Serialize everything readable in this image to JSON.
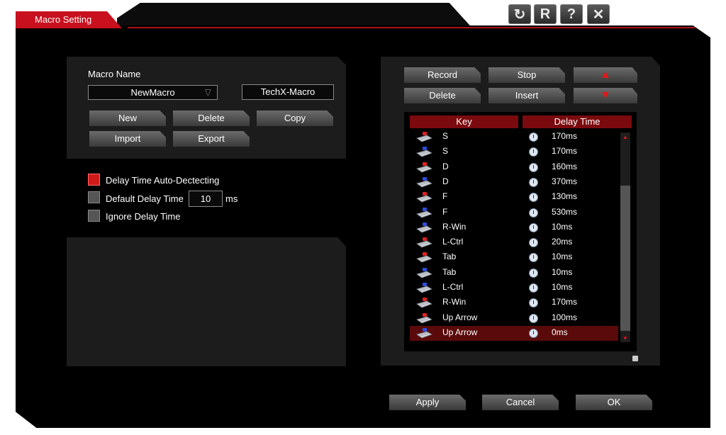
{
  "window": {
    "title": "Macro Setting",
    "buttons": {
      "refresh": "↻",
      "reset": "R",
      "help": "?",
      "close": "✕"
    }
  },
  "macro": {
    "name_label": "Macro Name",
    "name_value": "NewMacro",
    "profile_value": "TechX-Macro",
    "buttons": {
      "new": "New",
      "delete": "Delete",
      "copy": "Copy",
      "import": "Import",
      "export": "Export"
    }
  },
  "options": {
    "delay_auto": {
      "label": "Delay Time Auto-Dectecting",
      "checked": true
    },
    "default_delay": {
      "label": "Default Delay Time",
      "value": "10",
      "unit": "ms",
      "checked": false
    },
    "ignore_delay": {
      "label": "Ignore Delay Time",
      "checked": false
    }
  },
  "recorder": {
    "record": "Record",
    "stop": "Stop",
    "delete": "Delete",
    "insert": "Insert",
    "move_up_icon": "triangle-up-icon",
    "move_down_icon": "triangle-down-icon"
  },
  "table": {
    "headers": {
      "key": "Key",
      "delay": "Delay Time"
    },
    "rows": [
      {
        "key": "S",
        "delay": "170ms",
        "action": "press"
      },
      {
        "key": "S",
        "delay": "170ms",
        "action": "release"
      },
      {
        "key": "D",
        "delay": "160ms",
        "action": "press"
      },
      {
        "key": "D",
        "delay": "370ms",
        "action": "release"
      },
      {
        "key": "F",
        "delay": "130ms",
        "action": "press"
      },
      {
        "key": "F",
        "delay": "530ms",
        "action": "release"
      },
      {
        "key": "R-Win",
        "delay": "10ms",
        "action": "release"
      },
      {
        "key": "L-Ctrl",
        "delay": "20ms",
        "action": "press"
      },
      {
        "key": "Tab",
        "delay": "10ms",
        "action": "press"
      },
      {
        "key": "Tab",
        "delay": "10ms",
        "action": "release"
      },
      {
        "key": "L-Ctrl",
        "delay": "10ms",
        "action": "release"
      },
      {
        "key": "R-Win",
        "delay": "170ms",
        "action": "press"
      },
      {
        "key": "Up Arrow",
        "delay": "100ms",
        "action": "press"
      },
      {
        "key": "Up Arrow",
        "delay": "0ms",
        "action": "release",
        "selected": true
      }
    ]
  },
  "footer": {
    "apply": "Apply",
    "cancel": "Cancel",
    "ok": "OK"
  },
  "colors": {
    "accent": "#c8101e",
    "header_bg": "#7b0a0e",
    "panel_bg": "#1c1c1c"
  }
}
